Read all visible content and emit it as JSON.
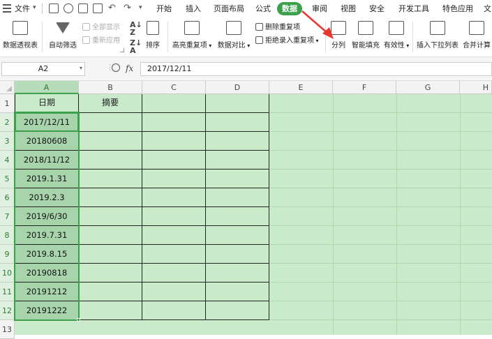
{
  "menu": {
    "file": "文件",
    "tabs": [
      "开始",
      "插入",
      "页面布局",
      "公式",
      "数据",
      "审阅",
      "视图",
      "安全",
      "开发工具",
      "特色应用",
      "文"
    ]
  },
  "ribbon": {
    "pivot": "数据透视表",
    "autofilter": "自动筛选",
    "show_all": "全部显示",
    "reapply": "重新应用",
    "sort": "排序",
    "highlight_dup": "高亮重复项",
    "compare": "数据对比",
    "remove_dup": "删除重复项",
    "reject_dup": "拒绝录入重复项",
    "text_to_columns": "分列",
    "flash_fill": "智能填充",
    "validity": "有效性",
    "insert_dropdown": "插入下拉列表",
    "consolidate": "合并计算"
  },
  "formula_bar": {
    "name_box": "A2",
    "fx": "fx",
    "value": "2017/12/11"
  },
  "sheet": {
    "columns": [
      "A",
      "B",
      "C",
      "D",
      "E",
      "F",
      "G",
      "H"
    ],
    "rows": [
      "1",
      "2",
      "3",
      "4",
      "5",
      "6",
      "7",
      "8",
      "9",
      "10",
      "11",
      "12",
      "13"
    ],
    "header_a": "日期",
    "header_b": "摘要",
    "dates": [
      "2017/12/11",
      "20180608",
      "2018/11/12",
      "2019.1.31",
      "2019.2.3",
      "2019/6/30",
      "2019.7.31",
      "2019.8.15",
      "20190818",
      "20191212",
      "20191222"
    ]
  },
  "colors": {
    "accent": "#3aa04a",
    "sheet_bg": "#c9ebca",
    "selected_col": "#a8d4ac",
    "arrow": "#e8382f"
  }
}
